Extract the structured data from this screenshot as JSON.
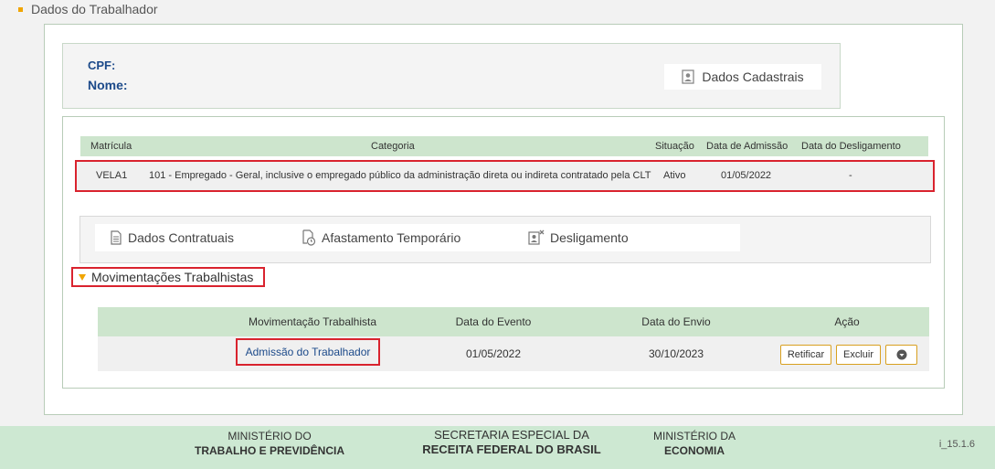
{
  "section": {
    "title": "Dados do Trabalhador"
  },
  "worker": {
    "cpf_label": "CPF:",
    "nome_label": "Nome:",
    "dados_cadastrais_label": "Dados Cadastrais"
  },
  "vinculo_table": {
    "headers": [
      "Matrícula",
      "Categoria",
      "Situação",
      "Data de Admissão",
      "Data do Desligamento"
    ],
    "row": {
      "matricula": "VELA1",
      "categoria": "101 - Empregado - Geral, inclusive o empregado público da administração direta ou indireta contratado pela CLT",
      "situacao": "Ativo",
      "data_admissao": "01/05/2022",
      "data_desligamento": "-"
    }
  },
  "tabs": {
    "dados_contratuais": "Dados Contratuais",
    "afastamento": "Afastamento Temporário",
    "desligamento": "Desligamento"
  },
  "movimentacoes": {
    "title": "Movimentações Trabalhistas",
    "headers": [
      "Movimentação Trabalhista",
      "Data do Evento",
      "Data do Envio",
      "Ação"
    ],
    "row": {
      "movimentacao": "Admissão do Trabalhador",
      "data_evento": "01/05/2022",
      "data_envio": "30/10/2023",
      "retificar": "Retificar",
      "excluir": "Excluir"
    }
  },
  "footer": {
    "org1_line1": "MINISTÉRIO DO",
    "org1_line2": "TRABALHO E PREVIDÊNCIA",
    "org2_line1": "SECRETARIA ESPECIAL DA",
    "org2_line2": "RECEITA FEDERAL DO BRASIL",
    "org3_line1": "MINISTÉRIO DA",
    "org3_line2": "ECONOMIA",
    "version": "i_15.1.6"
  },
  "colors": {
    "accent": "#f0a500",
    "header_green": "#cde5cd",
    "highlight_red": "#d9232e",
    "link_blue": "#1c4a8a"
  }
}
